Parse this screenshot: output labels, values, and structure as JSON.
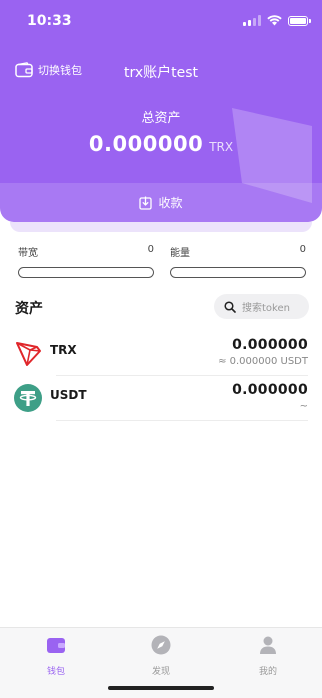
{
  "status_bar": {
    "time": "10:33"
  },
  "header": {
    "switch_wallet_label": "切换钱包",
    "wallet_name": "trx账户test",
    "total_assets_label": "总资产",
    "total_assets_value": "0.000000",
    "total_assets_unit": "TRX",
    "receive_label": "收款"
  },
  "resources": [
    {
      "label": "带宽",
      "value": "0"
    },
    {
      "label": "能量",
      "value": "0"
    }
  ],
  "assets": {
    "title": "资产",
    "search_placeholder": "搜索token",
    "tokens": [
      {
        "symbol": "TRX",
        "balance": "0.000000",
        "sub": "≈ 0.000000 USDT",
        "icon": "tron-icon"
      },
      {
        "symbol": "USDT",
        "balance": "0.000000",
        "sub": "~",
        "icon": "tether-icon"
      }
    ]
  },
  "tabbar": [
    {
      "label": "钱包",
      "icon": "wallet-icon",
      "active": true
    },
    {
      "label": "发现",
      "icon": "compass-icon",
      "active": false
    },
    {
      "label": "我的",
      "icon": "user-icon",
      "active": false
    }
  ],
  "colors": {
    "accent": "#9a63f1",
    "tron_red": "#e0272b",
    "tether_green": "#3e9f87"
  }
}
